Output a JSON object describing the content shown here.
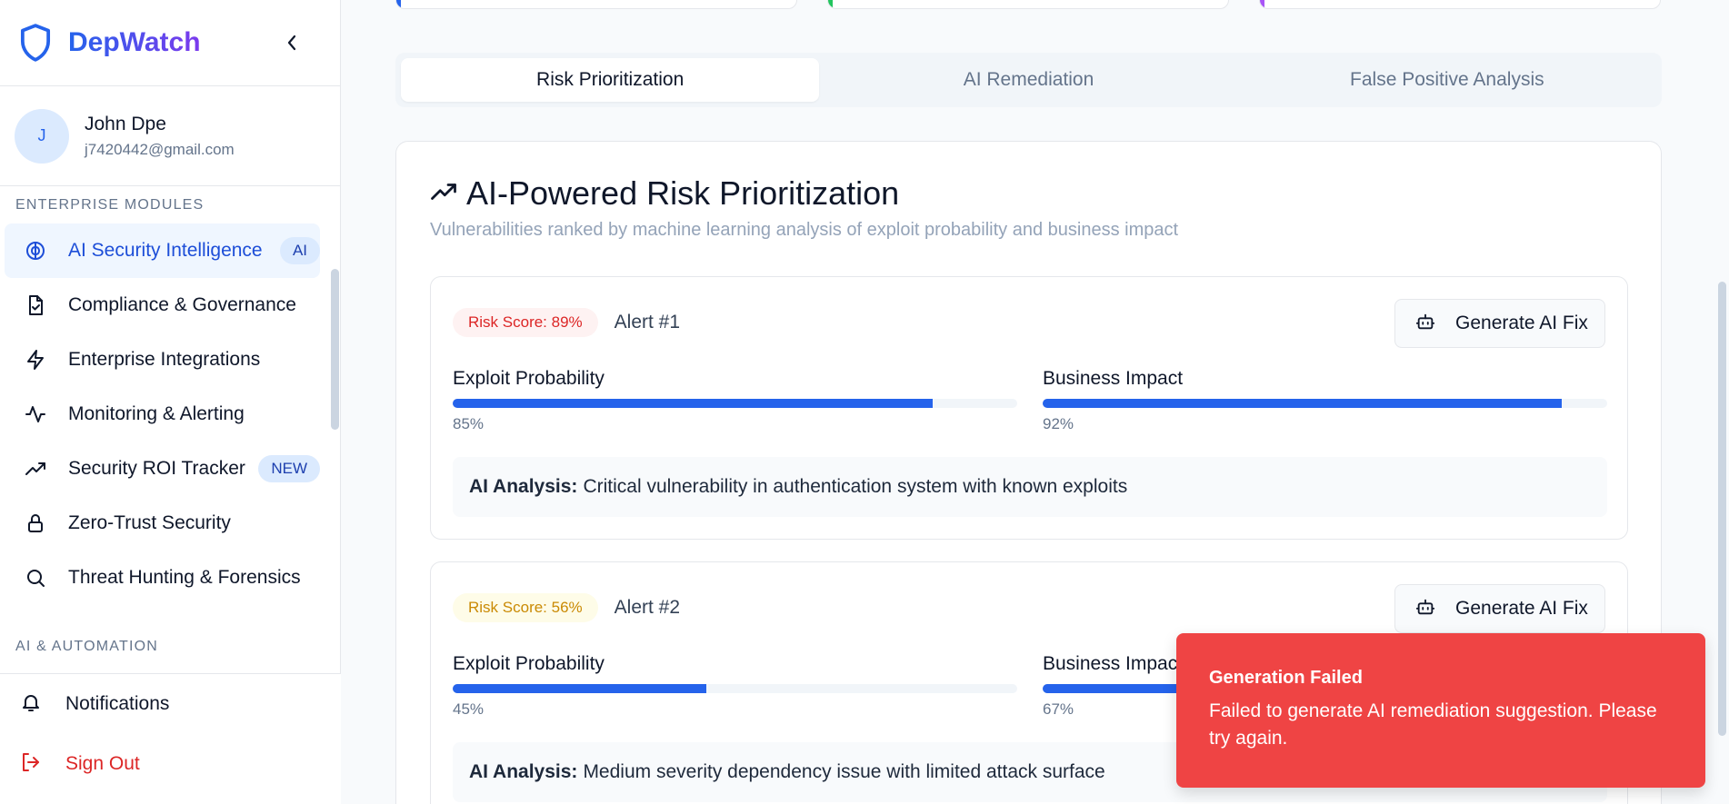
{
  "app": {
    "name": "DepWatch"
  },
  "user": {
    "initial": "J",
    "name": "John Dpe",
    "email": "j7420442@gmail.com"
  },
  "sidebar": {
    "section_enterprise": "ENTERPRISE MODULES",
    "items": [
      {
        "label": "AI Security Intelligence",
        "icon": "brain-icon",
        "badge": "AI",
        "active": true
      },
      {
        "label": "Compliance & Governance",
        "icon": "file-check-icon"
      },
      {
        "label": "Enterprise Integrations",
        "icon": "lightning-icon"
      },
      {
        "label": "Monitoring & Alerting",
        "icon": "activity-icon"
      },
      {
        "label": "Security ROI Tracker",
        "icon": "trending-up-icon",
        "badge": "NEW"
      },
      {
        "label": "Zero-Trust Security",
        "icon": "lock-icon"
      },
      {
        "label": "Threat Hunting & Forensics",
        "icon": "search-icon"
      }
    ],
    "section_ai": "AI & AUTOMATION",
    "bottom": {
      "notifications": "Notifications",
      "sign_out": "Sign Out"
    }
  },
  "tabs": [
    {
      "label": "Risk Prioritization",
      "active": true
    },
    {
      "label": "AI Remediation"
    },
    {
      "label": "False Positive Analysis"
    }
  ],
  "panel": {
    "title": "AI-Powered Risk Prioritization",
    "subtitle": "Vulnerabilities ranked by machine learning analysis of exploit probability and business impact"
  },
  "alerts": [
    {
      "risk_label": "Risk Score: 89%",
      "name": "Alert #1",
      "button": "Generate AI Fix",
      "exploit_label": "Exploit Probability",
      "exploit_value": "85%",
      "exploit_pct": 85,
      "impact_label": "Business Impact",
      "impact_value": "92%",
      "impact_pct": 92,
      "analysis_label": "AI Analysis:",
      "analysis_text": "Critical vulnerability in authentication system with known exploits"
    },
    {
      "risk_label": "Risk Score: 56%",
      "name": "Alert #2",
      "button": "Generate AI Fix",
      "exploit_label": "Exploit Probability",
      "exploit_value": "45%",
      "exploit_pct": 45,
      "impact_label": "Business Impact",
      "impact_value": "67%",
      "impact_pct": 67,
      "analysis_label": "AI Analysis:",
      "analysis_text": "Medium severity dependency issue with limited attack surface"
    }
  ],
  "toast": {
    "title": "Generation Failed",
    "description": "Failed to generate AI remediation suggestion. Please try again."
  },
  "colors": {
    "accent": "#2563eb",
    "danger": "#ef4444",
    "top_card_bars": [
      "#2563eb",
      "#22c55e",
      "#a855f7"
    ]
  }
}
